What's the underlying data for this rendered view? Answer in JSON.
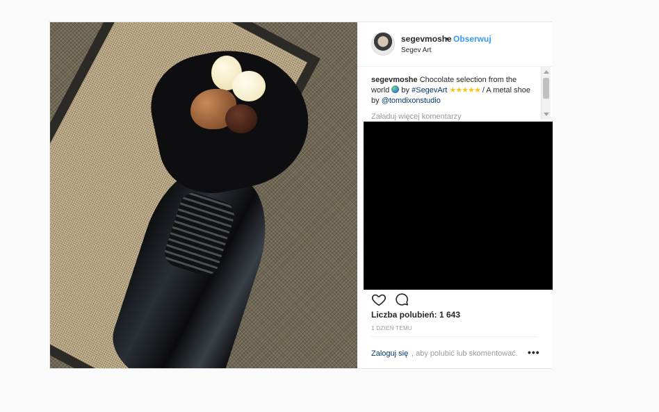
{
  "header": {
    "username": "segevmoshe",
    "separator": "•",
    "follow_label": "Obserwuj",
    "subtitle": "Segev Art"
  },
  "caption": {
    "username": "segevmoshe",
    "text_1": "Chocolate selection from the world",
    "text_2": "by",
    "hashtag": "#SegevArt",
    "stars": "★★★★★",
    "text_3": "/ A metal shoe by",
    "mention": "@tomdixonstudio"
  },
  "comments": {
    "load_more_label": "Załaduj więcej komentarzy"
  },
  "likes": {
    "text": "Liczba polubień: 1 643"
  },
  "time": {
    "text": "1 dzień temu"
  },
  "footer": {
    "login_label": "Zaloguj się",
    "login_rest": ", aby polubić lub skomentować.",
    "more_label": "•••"
  },
  "icons": {
    "like": "heart-icon",
    "comment": "comment-icon",
    "globe": "globe-emoji-icon"
  },
  "colors": {
    "link_blue": "#3897f0",
    "dark_link": "#003569",
    "muted": "#999999",
    "text": "#262626"
  }
}
